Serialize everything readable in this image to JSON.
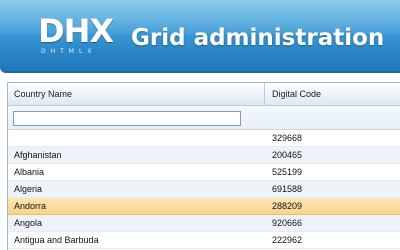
{
  "header": {
    "logo_mark": "DHX",
    "logo_sub": "DHTMLX",
    "title": "Grid administration"
  },
  "grid": {
    "columns": [
      "Country Name",
      "Digital Code"
    ],
    "filter": {
      "value": "",
      "placeholder": ""
    },
    "selected_row": 4,
    "rows": [
      {
        "name": "",
        "code": "329668"
      },
      {
        "name": "Afghanistan",
        "code": "200465"
      },
      {
        "name": "Albania",
        "code": "525199"
      },
      {
        "name": "Algeria",
        "code": "691588"
      },
      {
        "name": "Andorra",
        "code": "288209"
      },
      {
        "name": "Angola",
        "code": "920666"
      },
      {
        "name": "Antigua and Barbuda",
        "code": "222962"
      }
    ]
  },
  "colors": {
    "header_blue": "#2a86c8",
    "selection": "#f8d48a",
    "alt_row": "#eef3fa"
  }
}
